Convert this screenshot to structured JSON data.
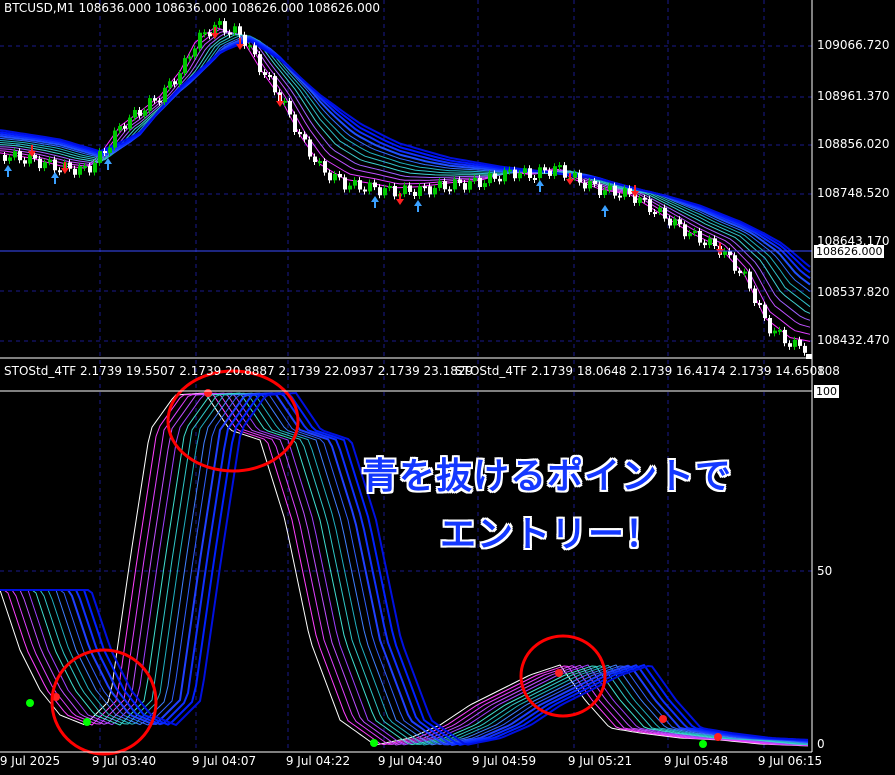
{
  "main_chart": {
    "title": "BTCUSD,M1  108636.000 108636.000 108626.000 108626.000",
    "price_levels": [
      "109066.720",
      "108961.370",
      "108856.020",
      "108748.520",
      "108643.170",
      "108537.820",
      "108432.470"
    ],
    "current_price": "108626.000"
  },
  "indicator": {
    "label_left": "STOStd_4TF 2.1739 19.5507 2.1739 20.8887 2.1739 22.0937 2.1739 23.1829",
    "label_right": "STOStd_4TF 2.1739 18.0648 2.1739 16.4174 2.1739 14.6508",
    "levels": [
      "108",
      "100",
      "50",
      "0"
    ]
  },
  "time_axis": [
    "9 Jul 2025",
    "9 Jul 03:40",
    "9 Jul 04:07",
    "9 Jul 04:22",
    "9 Jul 04:40",
    "9 Jul 04:59",
    "9 Jul 05:21",
    "9 Jul 05:48",
    "9 Jul 06:15"
  ],
  "annotation": {
    "line1": "青を抜けるポイントで",
    "line2": "エントリー！"
  },
  "colors": {
    "background": "#000000",
    "grid": "#1a1a8c",
    "bull_candle": "#00c800",
    "bear_candle": "#ffffff",
    "annotation_text": "#1438ff",
    "circle": "#ff0000"
  }
}
